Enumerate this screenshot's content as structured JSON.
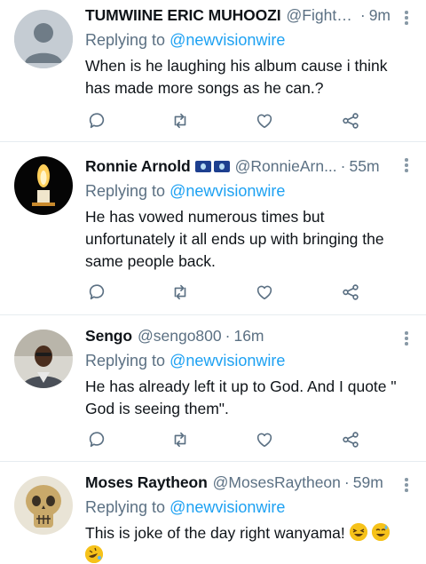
{
  "tweets": [
    {
      "name": "TUMWIINE ERIC MUHOOZI",
      "handle": "@Fighte...",
      "time": "9m",
      "replying_prefix": "Replying to",
      "replying_to": "@newvisionwire",
      "text_lines": [
        "When is he laughing his album cause i think",
        "has made more songs as he can.?"
      ],
      "avatar": "default-avatar-icon"
    },
    {
      "name": "Ronnie Arnold",
      "handle": "@RonnieArn...",
      "time": "55m",
      "replying_prefix": "Replying to",
      "replying_to": "@newvisionwire",
      "text_lines": [
        "He has vowed numerous times but",
        "unfortunately it all ends up with bringing the",
        "same people back."
      ],
      "avatar": "candle-avatar"
    },
    {
      "name": "Sengo",
      "handle": "@sengo800",
      "time": "16m",
      "replying_prefix": "Replying to",
      "replying_to": "@newvisionwire",
      "text_lines": [
        "He has already left it up to God. And I quote \"",
        "God is seeing them\"."
      ],
      "avatar": "photo-avatar"
    },
    {
      "name": "Moses Raytheon",
      "handle": "@MosesRaytheon",
      "time": "59m",
      "replying_prefix": "Replying to",
      "replying_to": "@newvisionwire",
      "text_lines": [
        "This is  joke of the day right wanyama!"
      ],
      "avatar": "skull-avatar"
    }
  ],
  "sep": "·",
  "colors": {
    "link": "#1da1f2",
    "muted": "#5b7083",
    "divider": "#e6ecf0"
  },
  "icons": [
    "reply-icon",
    "retweet-icon",
    "like-icon",
    "share-icon",
    "more-icon",
    "laughing-emoji",
    "sweat-smile-emoji",
    "rofl-emoji"
  ]
}
